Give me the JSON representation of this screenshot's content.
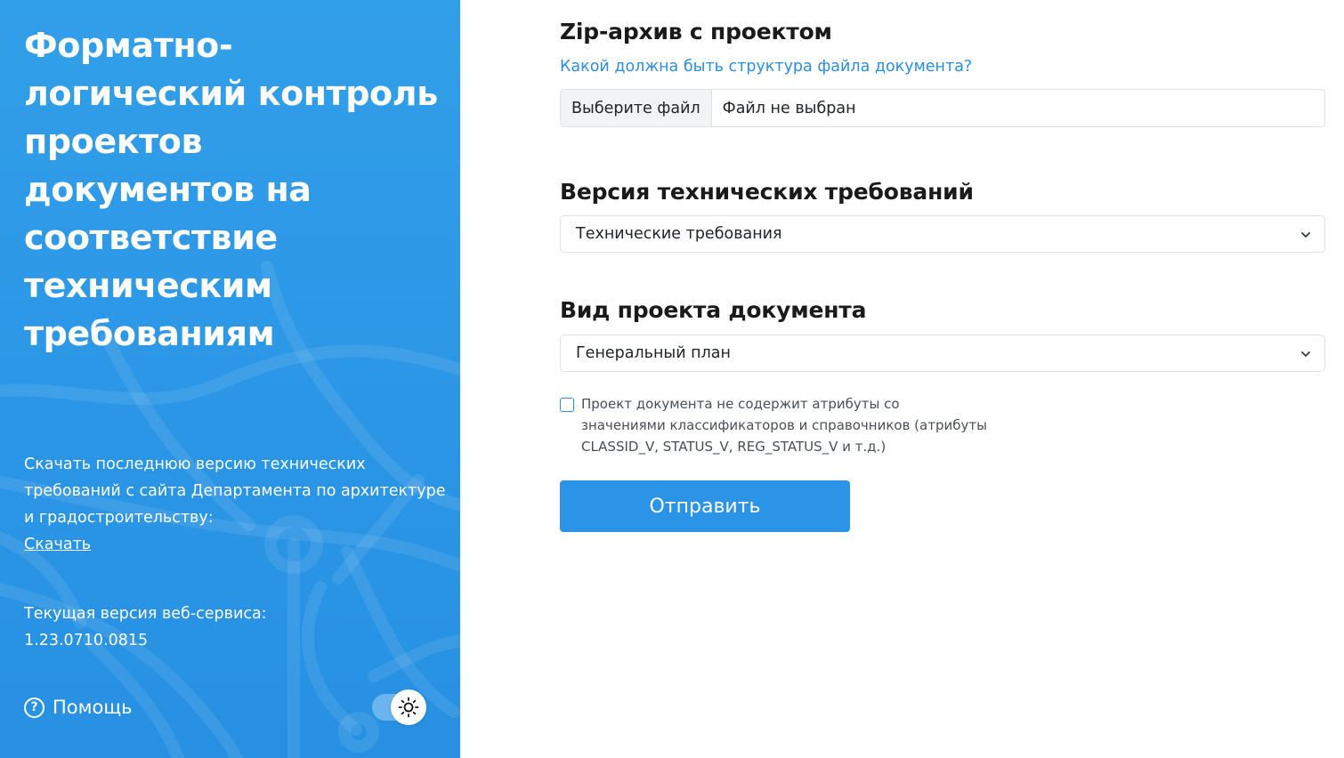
{
  "sidebar": {
    "title": "Форматно-логический контроль проектов документов на соответствие техническим требованиям",
    "download_text": "Скачать последнюю версию технических требований с сайта Департамента по архитектуре и градостроительству:",
    "download_link": "Скачать",
    "version_label": "Текущая версия веб-сервиса:",
    "version_value": "1.23.0710.0815",
    "help_label": "Помощь",
    "help_icon": "question-circle-icon",
    "theme_icon": "sun-icon"
  },
  "form": {
    "zip_title": "Zip-архив с проектом",
    "structure_link": "Какой должна быть структура файла документа?",
    "file_button": "Выберите файл",
    "file_status": "Файл не выбран",
    "tech_title": "Версия технических требований",
    "tech_select_value": "Технические требования",
    "kind_title": "Вид проекта документа",
    "kind_select_value": "Генеральный план",
    "checkbox_label": "Проект документа не содержит атрибуты со значениями классификаторов и справочников (атрибуты CLASSID_V, STATUS_V, REG_STATUS_V и т.д.)",
    "checkbox_checked": false,
    "submit_label": "Отправить"
  },
  "colors": {
    "sidebar_bg": "#2b96e6",
    "accent": "#2b94e6",
    "link": "#2b8fe0"
  }
}
